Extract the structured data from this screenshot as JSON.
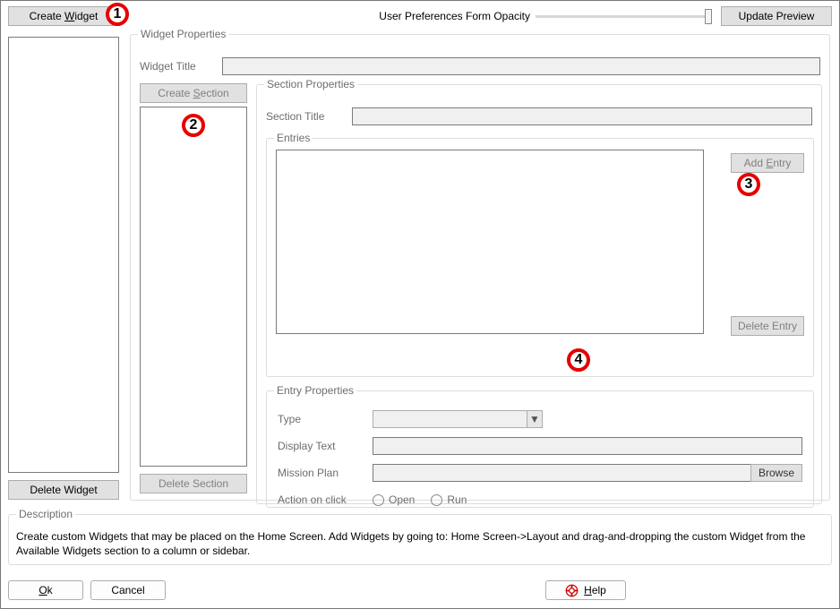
{
  "top": {
    "create_widget": "Create Widget",
    "create_widget_u": "W",
    "opacity_label": "User Preferences Form Opacity",
    "update_preview": "Update Preview"
  },
  "left": {
    "delete_widget": "Delete Widget"
  },
  "widget_props": {
    "legend": "Widget Properties",
    "title_label": "Widget Title",
    "title_value": "",
    "create_section": "Create Section",
    "create_section_u": "S",
    "delete_section": "Delete Section"
  },
  "section_props": {
    "legend": "Section Properties",
    "title_label": "Section Title",
    "title_value": ""
  },
  "entries": {
    "legend": "Entries",
    "add_entry": "Add Entry",
    "add_entry_u": "E",
    "delete_entry": "Delete Entry"
  },
  "entry_props": {
    "legend": "Entry Properties",
    "type_label": "Type",
    "type_value": "",
    "display_text_label": "Display Text",
    "display_text_value": "",
    "mission_plan_label": "Mission Plan",
    "mission_plan_value": "",
    "browse": "Browse",
    "action_label": "Action on click",
    "open": "Open",
    "run": "Run"
  },
  "description": {
    "legend": "Description",
    "text": "Create custom Widgets that may be placed on the Home Screen.  Add Widgets by going to: Home Screen->Layout and drag-and-dropping the custom Widget from the Available Widgets section to a column or sidebar."
  },
  "bottom": {
    "ok": "Ok",
    "ok_u": "O",
    "cancel": "Cancel",
    "help": "Help",
    "help_u": "H"
  },
  "markers": {
    "m1": "1",
    "m2": "2",
    "m3": "3",
    "m4": "4"
  }
}
